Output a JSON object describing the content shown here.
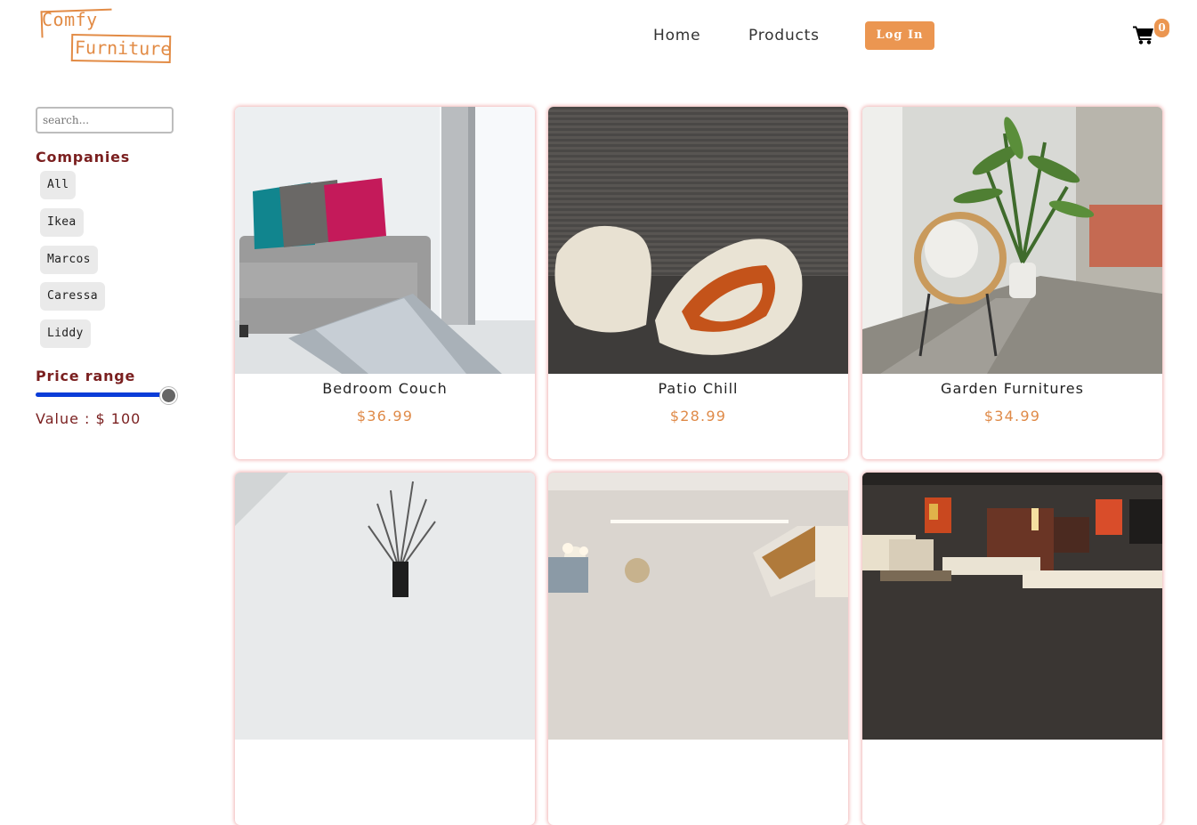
{
  "brand": {
    "line1": "Comfy",
    "line2": "Furniture"
  },
  "nav": {
    "home": "Home",
    "products": "Products",
    "login": "Log In",
    "cart_count": "0"
  },
  "sidebar": {
    "search_placeholder": "search...",
    "companies_heading": "Companies",
    "companies": [
      "All",
      "Ikea",
      "Marcos",
      "Caressa",
      "Liddy"
    ],
    "price_heading": "Price range",
    "price_value_text": "Value : $ 100",
    "price_slider_fraction": 1.0
  },
  "products": [
    {
      "name": "Bedroom Couch",
      "price": "$36.99"
    },
    {
      "name": "Patio Chill",
      "price": "$28.99"
    },
    {
      "name": "Garden Furnitures",
      "price": "$34.99"
    },
    {
      "name": "",
      "price": ""
    },
    {
      "name": "",
      "price": ""
    },
    {
      "name": "",
      "price": ""
    }
  ],
  "colors": {
    "accent": "#eb9651",
    "heading": "#7a1f1f",
    "slider": "#0b3dd8",
    "price": "#df8a48"
  }
}
